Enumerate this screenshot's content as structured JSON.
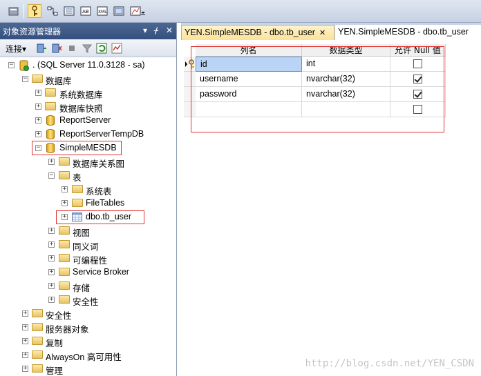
{
  "toolbar": {
    "icons": [
      "properties-icon",
      "key-icon",
      "relationships-icon",
      "indexes-icon",
      "fulltext-icon",
      "xml-icon",
      "check-constraints-icon",
      "spatial-icon",
      "overflow-icon"
    ]
  },
  "object_explorer": {
    "title": "对象资源管理器",
    "pin": "▾ ╤ ✕",
    "connect_label": "连接▾",
    "tree": [
      {
        "label": ". (SQL Server 11.0.3128 - sa)",
        "icon": "server-icon",
        "expanded": true
      },
      {
        "label": "数据库",
        "icon": "folder-icon",
        "expanded": true
      },
      {
        "label": "系统数据库",
        "icon": "folder-icon",
        "expanded": false
      },
      {
        "label": "数据库快照",
        "icon": "folder-icon",
        "expanded": false
      },
      {
        "label": "ReportServer",
        "icon": "database-icon",
        "expanded": false
      },
      {
        "label": "ReportServerTempDB",
        "icon": "database-icon",
        "expanded": false
      },
      {
        "label": "SimpleMESDB",
        "icon": "database-icon",
        "expanded": true
      },
      {
        "label": "数据库关系图",
        "icon": "folder-icon",
        "expanded": false
      },
      {
        "label": "表",
        "icon": "folder-icon",
        "expanded": true
      },
      {
        "label": "系统表",
        "icon": "folder-icon",
        "expanded": false
      },
      {
        "label": "FileTables",
        "icon": "folder-icon",
        "expanded": false
      },
      {
        "label": "dbo.tb_user",
        "icon": "table-icon",
        "expanded": false
      },
      {
        "label": "视图",
        "icon": "folder-icon",
        "expanded": false
      },
      {
        "label": "同义词",
        "icon": "folder-icon",
        "expanded": false
      },
      {
        "label": "可编程性",
        "icon": "folder-icon",
        "expanded": false
      },
      {
        "label": "Service Broker",
        "icon": "folder-icon",
        "expanded": false
      },
      {
        "label": "存储",
        "icon": "folder-icon",
        "expanded": false
      },
      {
        "label": "安全性",
        "icon": "folder-icon",
        "expanded": false
      },
      {
        "label": "安全性",
        "icon": "folder-icon",
        "expanded": false
      },
      {
        "label": "服务器对象",
        "icon": "folder-icon",
        "expanded": false
      },
      {
        "label": "复制",
        "icon": "folder-icon",
        "expanded": false
      },
      {
        "label": "AlwaysOn 高可用性",
        "icon": "folder-icon",
        "expanded": false
      },
      {
        "label": "管理",
        "icon": "folder-icon",
        "expanded": false
      }
    ]
  },
  "tabs": [
    {
      "label": "YEN.SimpleMESDB - dbo.tb_user",
      "close": "✕",
      "active": true
    },
    {
      "label": "YEN.SimpleMESDB - dbo.tb_user",
      "active": false
    }
  ],
  "designer": {
    "columns": [
      "列名",
      "数据类型",
      "允许 Null 值"
    ],
    "rows": [
      {
        "name": "id",
        "type": "int",
        "nullable": false,
        "primary_key": true
      },
      {
        "name": "username",
        "type": "nvarchar(32)",
        "nullable": true,
        "primary_key": false
      },
      {
        "name": "password",
        "type": "nvarchar(32)",
        "nullable": true,
        "primary_key": false
      },
      {
        "name": "",
        "type": "",
        "nullable": false,
        "primary_key": false
      }
    ]
  },
  "watermark": "http://blog.csdn.net/YEN_CSDN",
  "colors": {
    "highlight": "#e03030",
    "selection": "#b9d4f5",
    "title_bar": "#3d5886"
  }
}
